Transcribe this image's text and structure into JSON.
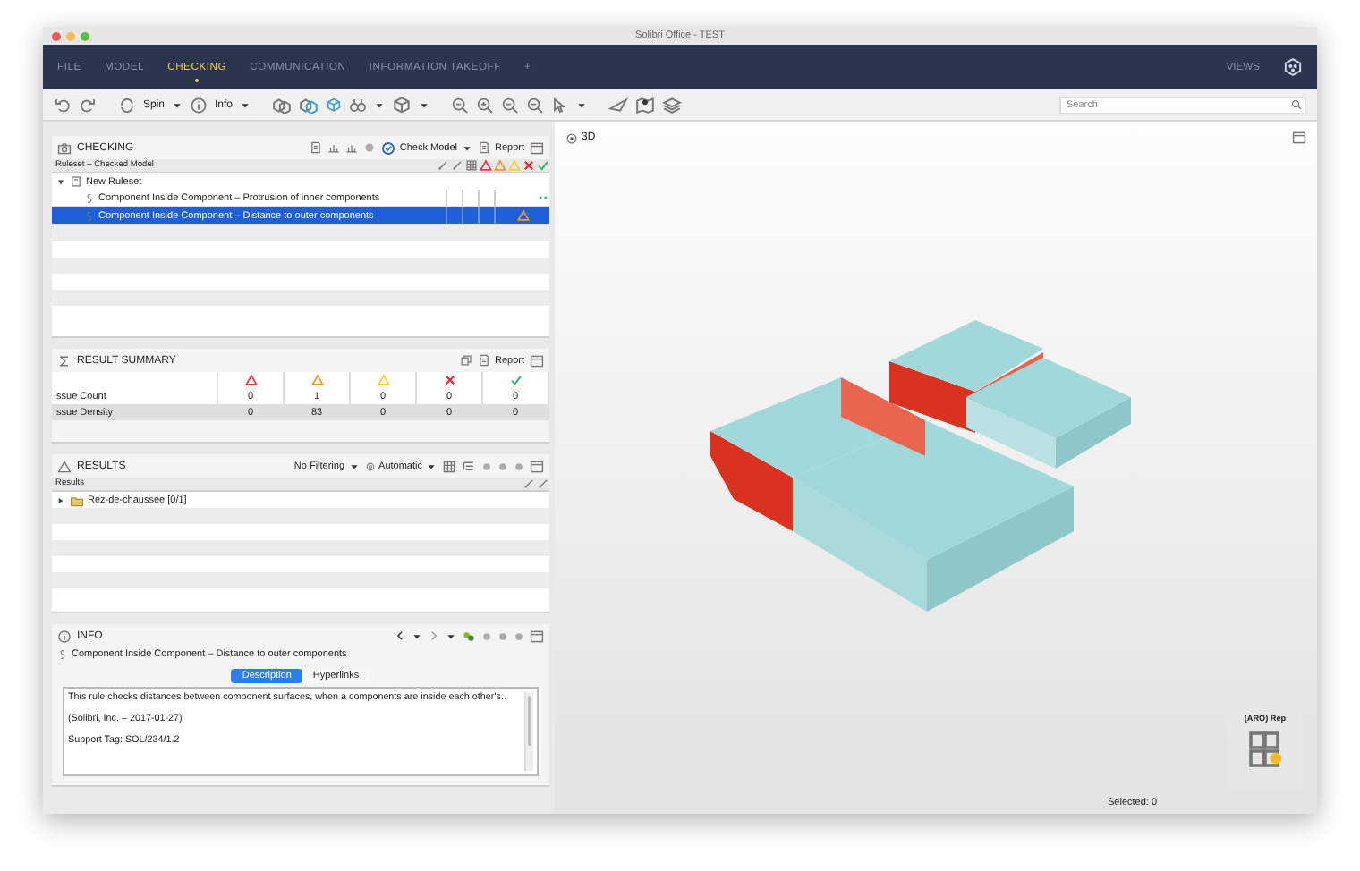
{
  "window": {
    "title": "Solibri Office - TEST"
  },
  "nav": {
    "tabs": [
      {
        "label": "FILE",
        "selected": false
      },
      {
        "label": "MODEL",
        "selected": false
      },
      {
        "label": "CHECKING",
        "selected": true
      },
      {
        "label": "COMMUNICATION",
        "selected": false
      },
      {
        "label": "INFORMATION TAKEOFF",
        "selected": false
      },
      {
        "label": "+",
        "selected": false
      }
    ],
    "views": "VIEWS"
  },
  "toolbar": {
    "spin": "Spin",
    "info": "Info",
    "search": {
      "placeholder": "Search"
    }
  },
  "checking": {
    "title": "CHECKING",
    "check_model": "Check Model",
    "report": "Report",
    "column": "Ruleset – Checked Model",
    "tree": [
      {
        "label": "New Ruleset",
        "expanded": true,
        "children": [
          {
            "label": "Component Inside Component – Protrusion of inner components",
            "selected": false,
            "kind": "passed"
          },
          {
            "label": "Component Inside Component – Distance to outer components",
            "selected": true,
            "kind": "moderate"
          }
        ]
      }
    ]
  },
  "result_summary": {
    "title": "RESULT SUMMARY",
    "report": "Report",
    "columns": [
      {
        "kind": "critical"
      },
      {
        "kind": "moderate"
      },
      {
        "kind": "low"
      },
      {
        "kind": "rejected"
      },
      {
        "kind": "accepted"
      }
    ],
    "rows": [
      {
        "label": "Issue Count",
        "values": [
          "0",
          "1",
          "0",
          "0",
          "0"
        ]
      },
      {
        "label": "Issue Density",
        "values": [
          "0",
          "83",
          "0",
          "0",
          "0"
        ]
      }
    ]
  },
  "results": {
    "title": "RESULTS",
    "filter": "No Filtering",
    "mode": "Automatic",
    "column": "Results",
    "rows": [
      {
        "label": "Rez-de-chaussée [0/1]",
        "expanded": false
      }
    ]
  },
  "info": {
    "title": "INFO",
    "rule": "Component Inside Component – Distance to outer components",
    "tabs": [
      {
        "label": "Description",
        "selected": true
      },
      {
        "label": "Hyperlinks",
        "selected": false
      }
    ],
    "paragraphs": [
      "This rule checks distances between component surfaces, when a components are inside each other's.",
      "(Solibri, Inc. – 2017-01-27)",
      "Support Tag: SOL/234/1.2"
    ]
  },
  "viewport": {
    "title": "3D",
    "cube_label": "(ARO) Rep"
  },
  "status_bar": {
    "selected": "Selected: 0"
  }
}
